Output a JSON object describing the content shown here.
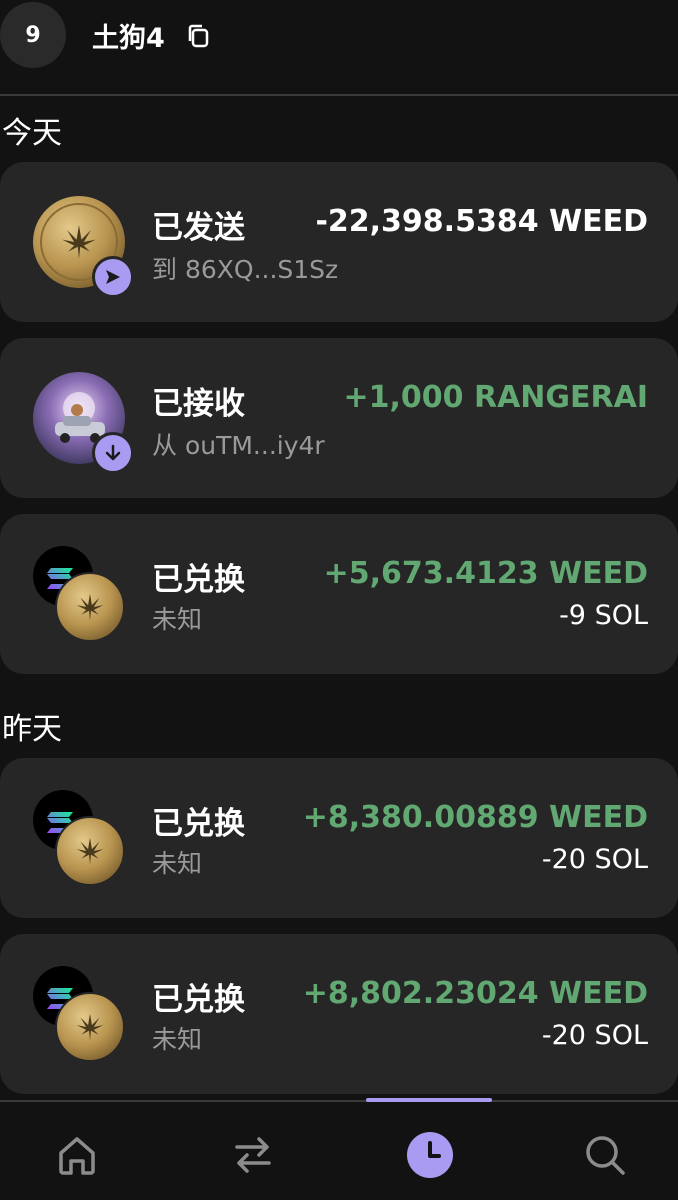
{
  "header": {
    "avatar_text": "9",
    "account_name": "土狗4"
  },
  "sections": {
    "today": "今天",
    "yesterday": "昨天"
  },
  "transactions": [
    {
      "title": "已发送",
      "subtitle": "到 86XQ...S1Sz",
      "amount": "-22,398.5384 WEED",
      "amount_status": "negative",
      "icon": "weed-coin-icon",
      "badge": "send-icon"
    },
    {
      "title": "已接收",
      "subtitle": "从 ouTM...iy4r",
      "amount": "+1,000 RANGERAI",
      "amount_status": "positive",
      "icon": "rangerai-token-icon",
      "badge": "receive-icon"
    },
    {
      "title": "已兑换",
      "subtitle": "未知",
      "amount": "+5,673.4123 WEED",
      "amount2": "-9 SOL",
      "amount_status": "positive",
      "icon": "swap-sol-weed-icon"
    },
    {
      "title": "已兑换",
      "subtitle": "未知",
      "amount": "+8,380.00889 WEED",
      "amount2": "-20 SOL",
      "amount_status": "positive",
      "icon": "swap-sol-weed-icon"
    },
    {
      "title": "已兑换",
      "subtitle": "未知",
      "amount": "+8,802.23024 WEED",
      "amount2": "-20 SOL",
      "amount_status": "positive",
      "icon": "swap-sol-weed-icon"
    }
  ],
  "nav": {
    "items": [
      "home-icon",
      "swap-icon",
      "history-icon",
      "search-icon"
    ],
    "active": "history-icon"
  },
  "colors": {
    "background": "#121212",
    "card": "#262626",
    "accent": "#a99bf2",
    "positive": "#62a872",
    "muted": "#9a9a9a"
  }
}
